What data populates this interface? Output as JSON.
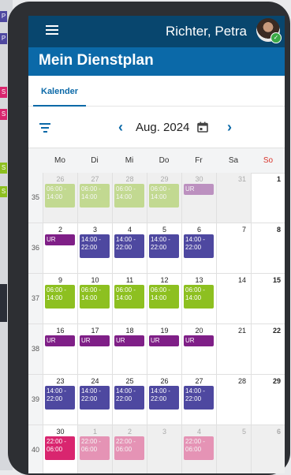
{
  "background": {
    "tabs": [
      {
        "label": "P",
        "color": "#4e48a0"
      },
      {
        "label": "P",
        "color": "#4e48a0"
      },
      {
        "label": "S",
        "color": "#d9256f"
      },
      {
        "label": "S",
        "color": "#d9256f"
      },
      {
        "label": "S",
        "color": "#8dc020"
      },
      {
        "label": "S",
        "color": "#8dc020"
      }
    ]
  },
  "header": {
    "user_name": "Richter, Petra",
    "page_title": "Mein Dienstplan"
  },
  "tabs": [
    {
      "label": "Kalender",
      "active": true
    }
  ],
  "toolbar": {
    "month_label": "Aug. 2024",
    "prev": "‹",
    "next": "›"
  },
  "weekdays": [
    "Mo",
    "Di",
    "Mi",
    "Do",
    "Fr",
    "Sa",
    "So"
  ],
  "weeks": [
    {
      "kw": "35",
      "days": [
        {
          "num": "26",
          "out": true,
          "shift": {
            "text": "06:00 - 14:00",
            "color": "green"
          }
        },
        {
          "num": "27",
          "out": true,
          "shift": {
            "text": "06:00 - 14:00",
            "color": "green"
          }
        },
        {
          "num": "28",
          "out": true,
          "shift": {
            "text": "06:00 - 14:00",
            "color": "green"
          }
        },
        {
          "num": "29",
          "out": true,
          "shift": {
            "text": "06:00 - 14:00",
            "color": "green"
          }
        },
        {
          "num": "30",
          "out": true,
          "shift": {
            "text": "UR",
            "color": "purple"
          }
        },
        {
          "num": "31",
          "out": true
        },
        {
          "num": "1",
          "out": false
        }
      ]
    },
    {
      "kw": "36",
      "days": [
        {
          "num": "2",
          "shift": {
            "text": "UR",
            "color": "purple"
          }
        },
        {
          "num": "3",
          "shift": {
            "text": "14:00 - 22:00",
            "color": "navy"
          }
        },
        {
          "num": "4",
          "shift": {
            "text": "14:00 - 22:00",
            "color": "navy"
          }
        },
        {
          "num": "5",
          "shift": {
            "text": "14:00 - 22:00",
            "color": "navy"
          }
        },
        {
          "num": "6",
          "shift": {
            "text": "14:00 - 22:00",
            "color": "navy"
          }
        },
        {
          "num": "7"
        },
        {
          "num": "8"
        }
      ]
    },
    {
      "kw": "37",
      "days": [
        {
          "num": "9",
          "shift": {
            "text": "06:00 - 14:00",
            "color": "green"
          }
        },
        {
          "num": "10",
          "shift": {
            "text": "06:00 - 14:00",
            "color": "green"
          }
        },
        {
          "num": "11",
          "shift": {
            "text": "06:00 - 14:00",
            "color": "green"
          }
        },
        {
          "num": "12",
          "shift": {
            "text": "06:00 - 14:00",
            "color": "green"
          }
        },
        {
          "num": "13",
          "shift": {
            "text": "06:00 - 14:00",
            "color": "green"
          }
        },
        {
          "num": "14"
        },
        {
          "num": "15"
        }
      ]
    },
    {
      "kw": "38",
      "days": [
        {
          "num": "16",
          "shift": {
            "text": "UR",
            "color": "purple"
          }
        },
        {
          "num": "17",
          "shift": {
            "text": "UR",
            "color": "purple"
          }
        },
        {
          "num": "18",
          "shift": {
            "text": "UR",
            "color": "purple"
          }
        },
        {
          "num": "19",
          "shift": {
            "text": "UR",
            "color": "purple"
          }
        },
        {
          "num": "20",
          "shift": {
            "text": "UR",
            "color": "purple"
          }
        },
        {
          "num": "21"
        },
        {
          "num": "22"
        }
      ]
    },
    {
      "kw": "39",
      "days": [
        {
          "num": "23",
          "shift": {
            "text": "14:00 - 22:00",
            "color": "navy"
          }
        },
        {
          "num": "24",
          "shift": {
            "text": "14:00 - 22:00",
            "color": "navy"
          }
        },
        {
          "num": "25",
          "shift": {
            "text": "14:00 - 22:00",
            "color": "navy"
          }
        },
        {
          "num": "26",
          "shift": {
            "text": "14:00 - 22:00",
            "color": "navy"
          }
        },
        {
          "num": "27",
          "shift": {
            "text": "14:00 - 22:00",
            "color": "navy"
          }
        },
        {
          "num": "28"
        },
        {
          "num": "29"
        }
      ]
    },
    {
      "kw": "40",
      "days": [
        {
          "num": "30",
          "shift": {
            "text": "22:00 - 06:00",
            "color": "pink"
          }
        },
        {
          "num": "1",
          "out": true,
          "shift": {
            "text": "22:00 - 06:00",
            "color": "pink"
          }
        },
        {
          "num": "2",
          "out": true,
          "shift": {
            "text": "22:00 - 06:00",
            "color": "pink"
          }
        },
        {
          "num": "3",
          "out": true
        },
        {
          "num": "4",
          "out": true,
          "shift": {
            "text": "22:00 - 06:00",
            "color": "pink"
          }
        },
        {
          "num": "5",
          "out": true
        },
        {
          "num": "6",
          "out": true
        }
      ]
    }
  ]
}
